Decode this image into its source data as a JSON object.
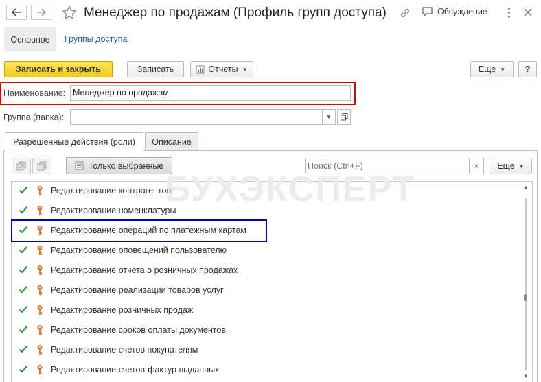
{
  "window": {
    "title": "Менеджер по продажам (Профиль групп доступа)",
    "discussion_label": "Обсуждение"
  },
  "section_tabs": [
    {
      "label": "Основное",
      "active": true
    },
    {
      "label": "Группы доступа",
      "active": false
    }
  ],
  "toolbar": {
    "save_close_label": "Записать и закрыть",
    "save_label": "Записать",
    "reports_label": "Отчеты",
    "more_label": "Еще",
    "help_label": "?"
  },
  "fields": {
    "name_label": "Наименование:",
    "name_value": "Менеджер по продажам",
    "group_label": "Группа (папка):",
    "group_value": ""
  },
  "content_tabs": [
    {
      "label": "Разрешенные действия (роли)",
      "active": true
    },
    {
      "label": "Описание",
      "active": false
    }
  ],
  "list_toolbar": {
    "only_selected_label": "Только выбранные",
    "search_placeholder": "Поиск (Ctrl+F)",
    "more_label": "Еще"
  },
  "watermark": "БУХЭКСПЕРТ",
  "roles": [
    {
      "label": "Редактирование контрагентов",
      "checked": true
    },
    {
      "label": "Редактирование номенклатуры",
      "checked": true
    },
    {
      "label": "Редактирование операций по платежным картам",
      "checked": true
    },
    {
      "label": "Редактирование оповещений пользователю",
      "checked": true
    },
    {
      "label": "Редактирование отчета о розничных продажах",
      "checked": true
    },
    {
      "label": "Редактирование реализации товаров услуг",
      "checked": true
    },
    {
      "label": "Редактирование розничных продаж",
      "checked": true
    },
    {
      "label": "Редактирование сроков оплаты документов",
      "checked": true
    },
    {
      "label": "Редактирование счетов покупателям",
      "checked": true
    },
    {
      "label": "Редактирование счетов-фактур выданных",
      "checked": true
    }
  ],
  "colors": {
    "primary_button": "#f5d21c",
    "highlight_red": "#e00000",
    "highlight_blue": "#0000cc",
    "check_green": "#2e9b3a",
    "key_orange": "#e07a2a",
    "link_blue": "#2a5db0"
  }
}
